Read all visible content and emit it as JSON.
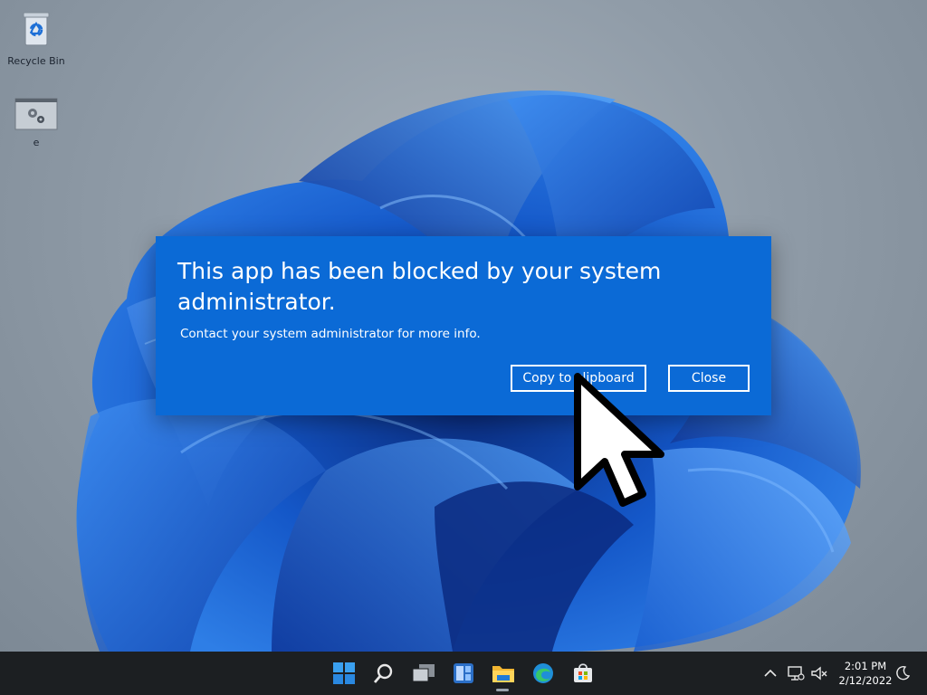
{
  "desktop": {
    "icons": [
      {
        "label": "Recycle Bin",
        "icon": "recycle-bin-icon"
      },
      {
        "label": "e",
        "icon": "settings-shortcut-icon"
      }
    ]
  },
  "dialog": {
    "title": "This app has been blocked by your system administrator.",
    "message": "Contact your system administrator for more info.",
    "copy_label": "Copy to clipboard",
    "close_label": "Close"
  },
  "taskbar": {
    "icons": [
      "start-icon",
      "search-icon",
      "task-view-icon",
      "widgets-icon",
      "file-explorer-icon",
      "edge-icon",
      "store-icon"
    ],
    "tray": [
      "chevron-up-icon",
      "network-icon",
      "volume-muted-icon",
      "focus-moon-icon"
    ],
    "time": "2:01 PM",
    "date": "2/12/2022"
  },
  "colors": {
    "dialog_bg": "#0b6ad6",
    "taskbar_bg": "#1c1f22",
    "accent": "#0078d4"
  }
}
